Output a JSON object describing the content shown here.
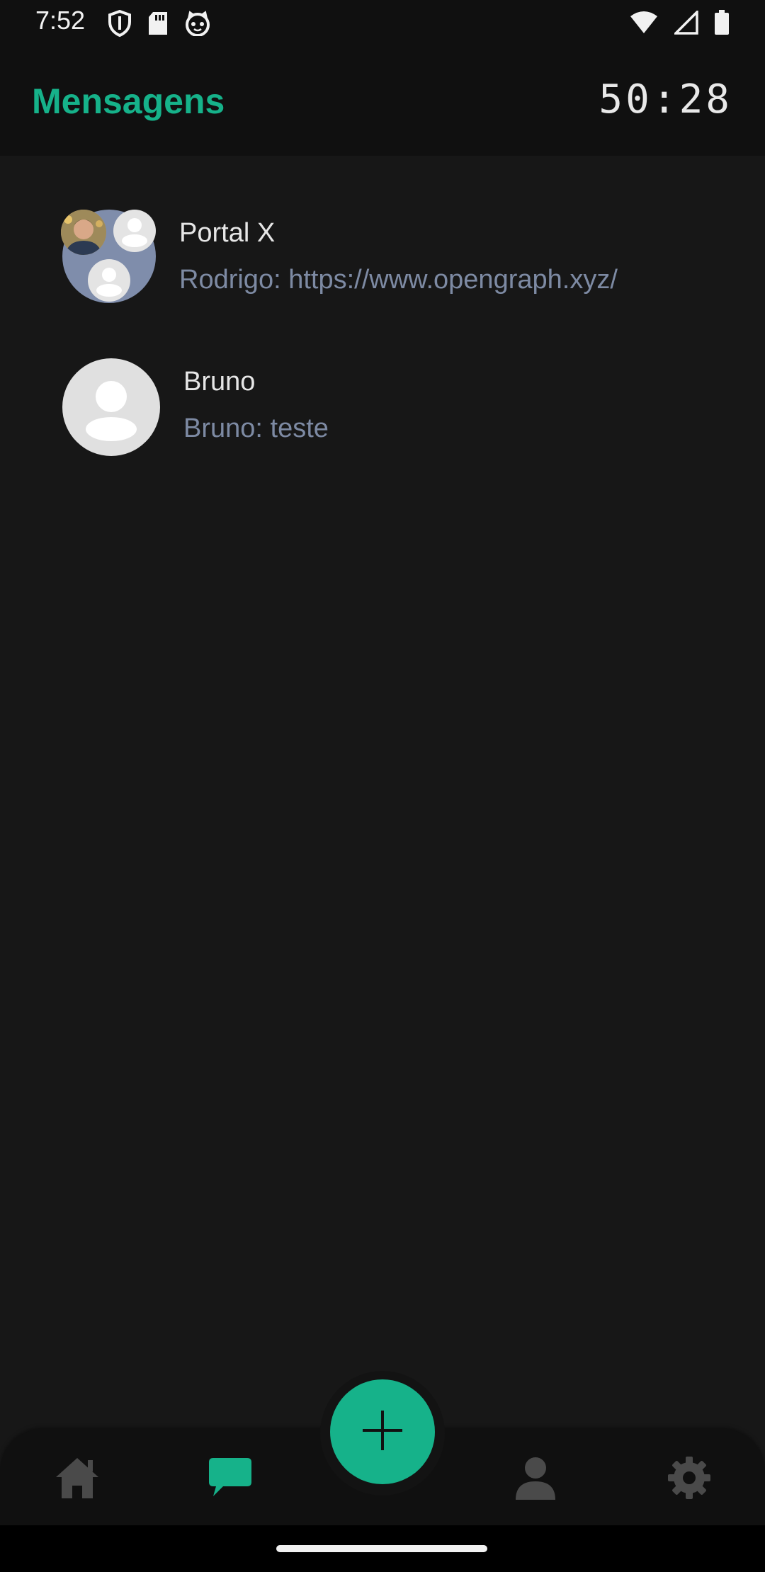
{
  "status_bar": {
    "time": "7:52",
    "left_icons": [
      "shield-icon",
      "sd-card-icon",
      "cat-face-icon"
    ],
    "right_icons": [
      "wifi-icon",
      "signal-icon",
      "battery-icon"
    ]
  },
  "header": {
    "title": "Mensagens",
    "timer": "50:28"
  },
  "conversations": [
    {
      "name": "Portal X",
      "preview": "Rodrigo: https://www.opengraph.xyz/",
      "avatar": "group-avatar"
    },
    {
      "name": "Bruno",
      "preview": "Bruno: teste",
      "avatar": "person-placeholder-icon"
    }
  ],
  "bottom_nav": {
    "items": [
      "home-icon",
      "chat-icon",
      "person-icon",
      "gear-icon"
    ],
    "active": "chat-icon"
  },
  "fab": {
    "icon": "plus-icon"
  },
  "colors": {
    "accent": "#16b28a",
    "background": "#171717",
    "header_background": "#101010",
    "preview_text": "#7d8aa3",
    "nav_inactive": "#4a4a4a"
  }
}
